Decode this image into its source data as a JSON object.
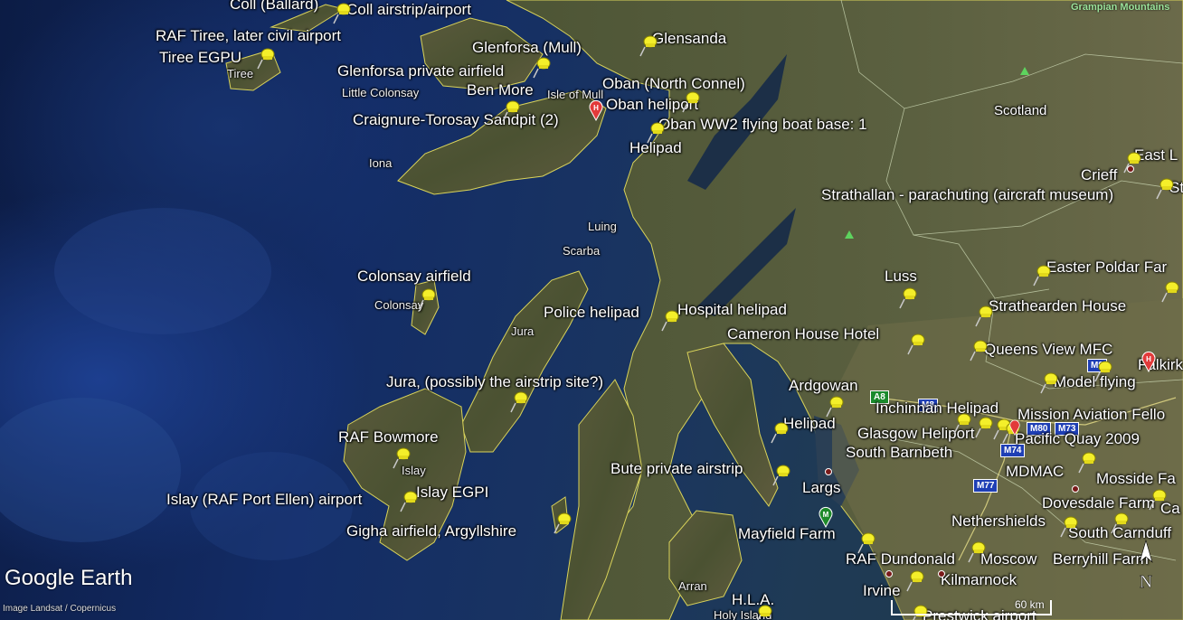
{
  "map": {
    "brand": "Google Earth",
    "credit": "Image Landsat / Copernicus",
    "scale_label": "60 km",
    "compass_letter": "N",
    "region_label": "Grampian Mountains",
    "place_labels": {
      "tiree": "Tiree",
      "little_colonsay": "Little Colonsay",
      "isle_of_mull": "Isle of Mull",
      "iona": "Iona",
      "luing": "Luing",
      "scarba": "Scarba",
      "colonsay": "Colonsay",
      "jura": "Jura",
      "islay": "Islay",
      "arran": "Arran",
      "holy_island": "Holy Island",
      "scotland": "Scotland"
    },
    "placemarks": {
      "coll_ballard": "Coll (Ballard)",
      "coll_airstrip": "Coll airstrip/airport",
      "raf_tiree": "RAF Tiree, later civil airport",
      "tiree_egpu": "Tiree EGPU",
      "glenforsa_mull": "Glenforsa (Mull)",
      "glensanda": "Glensanda",
      "glenforsa_private": "Glenforsa private airfield",
      "ben_more": "Ben More",
      "oban_north_connel": "Oban (North Connel)",
      "oban_heliport": "Oban heliport",
      "craignure": "Craignure-Torosay Sandpit (2)",
      "oban_ww2": "Oban WW2 flying boat base: 1",
      "helipad_oban": "Helipad",
      "east_l": "East L",
      "crieff": "Crieff",
      "st": "St",
      "strathallan": "Strathallan - parachuting (aircraft museum)",
      "colonsay_airfield": "Colonsay airfield",
      "luss": "Luss",
      "easter_poldar": "Easter Poldar Far",
      "strathearden": "Strathearden House",
      "police_helipad": "Police helipad",
      "hospital_helipad": "Hospital helipad",
      "cameron_house": "Cameron House Hotel",
      "queens_view": "Queens View MFC",
      "falkirk": "Falkirk",
      "model_flying": "Model flying",
      "jura_airstrip": "Jura, (possibly the airstrip site?)",
      "ardgowan": "Ardgowan",
      "inchinnan": "Inchinnan Helipad",
      "mission_aviation": "Mission Aviation Fello",
      "helipad_clyde": "Helipad",
      "glasgow_heliport": "Glasgow Heliport",
      "pacific_quay": "Pacific Quay 2009",
      "raf_bowmore": "RAF Bowmore",
      "south_barnbeth": "South Barnbeth",
      "mdmac": "MDMAC",
      "mosside": "Mosside Fa",
      "bute": "Bute private airstrip",
      "largs": "Largs",
      "islay_port_ellen": "Islay (RAF Port Ellen) airport",
      "islay_egpi": "Islay EGPI",
      "dovesdale": "Dovesdale Farm",
      "nethershields": "Nethershields",
      "south_carnduff": "South Carnduff",
      "ca": "Ca",
      "gigha": "Gigha airfield, Argyllshire",
      "mayfield": "Mayfield Farm",
      "raf_dundonald": "RAF Dundonald",
      "moscow": "Moscow",
      "berryhill": "Berryhill Farm",
      "irvine": "Irvine",
      "kilmarnock": "Kilmarnock",
      "hla": "H.L.A.",
      "prestwick": "Prestwick airport"
    },
    "roads": {
      "a8": "A8",
      "m8": "M8",
      "m80": "M80",
      "m73": "M73",
      "m74": "M74",
      "m77": "M77",
      "m9": "M9"
    },
    "colors": {
      "pin": "#f4ef2a",
      "coastline": "#d9d35a",
      "border": "#d8e6c0",
      "hospital_marker": "#e23a3a"
    }
  }
}
